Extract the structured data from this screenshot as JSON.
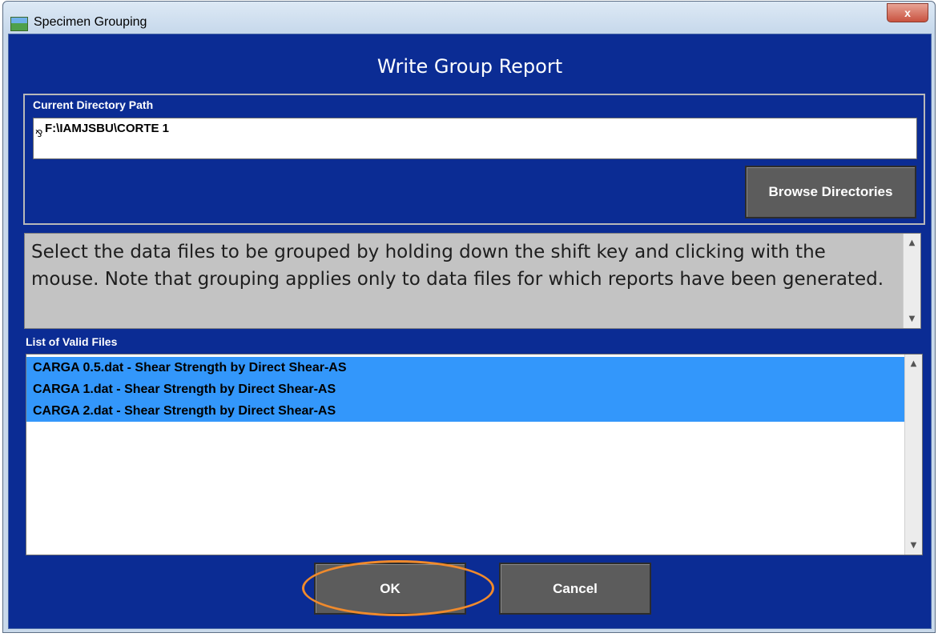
{
  "window": {
    "title": "Specimen Grouping",
    "close_label": "x"
  },
  "dialog": {
    "heading": "Write Group Report",
    "directory": {
      "label": "Current Directory Path",
      "path": "F:\\IAMJSBU\\CORTE 1",
      "browse_label": "Browse Directories"
    },
    "instruction": "Select the data files to be grouped by holding down the shift key and clicking with the mouse.  Note that grouping applies only to data files for which reports have been generated.",
    "files": {
      "label": "List of Valid Files",
      "items": [
        "CARGA 0.5.dat - Shear Strength by Direct Shear-AS",
        "CARGA 1.dat - Shear Strength by Direct Shear-AS",
        "CARGA 2.dat - Shear Strength by Direct Shear-AS"
      ]
    },
    "ok_label": "OK",
    "cancel_label": "Cancel"
  },
  "colors": {
    "client_background": "#0b2c94",
    "selection": "#3397fb",
    "button": "#5c5c5c",
    "annotation_ring": "#f08a2c"
  }
}
